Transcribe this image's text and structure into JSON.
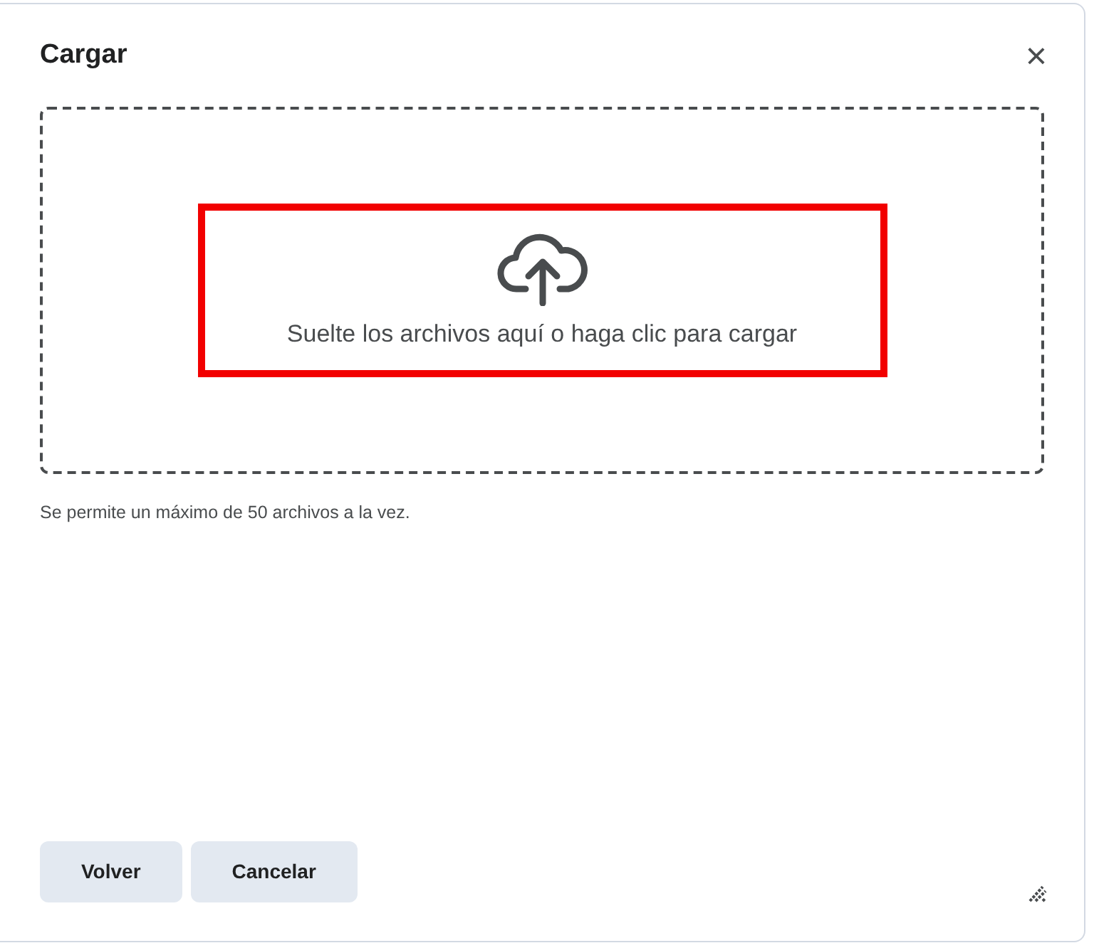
{
  "dialog": {
    "title": "Cargar",
    "close_icon": "×"
  },
  "dropzone": {
    "text": "Suelte los archivos aquí o haga clic para cargar",
    "highlighted": true
  },
  "note": "Se permite un máximo de 50 archivos a la vez.",
  "buttons": [
    {
      "label": "Volver"
    },
    {
      "label": "Cancelar"
    }
  ]
}
